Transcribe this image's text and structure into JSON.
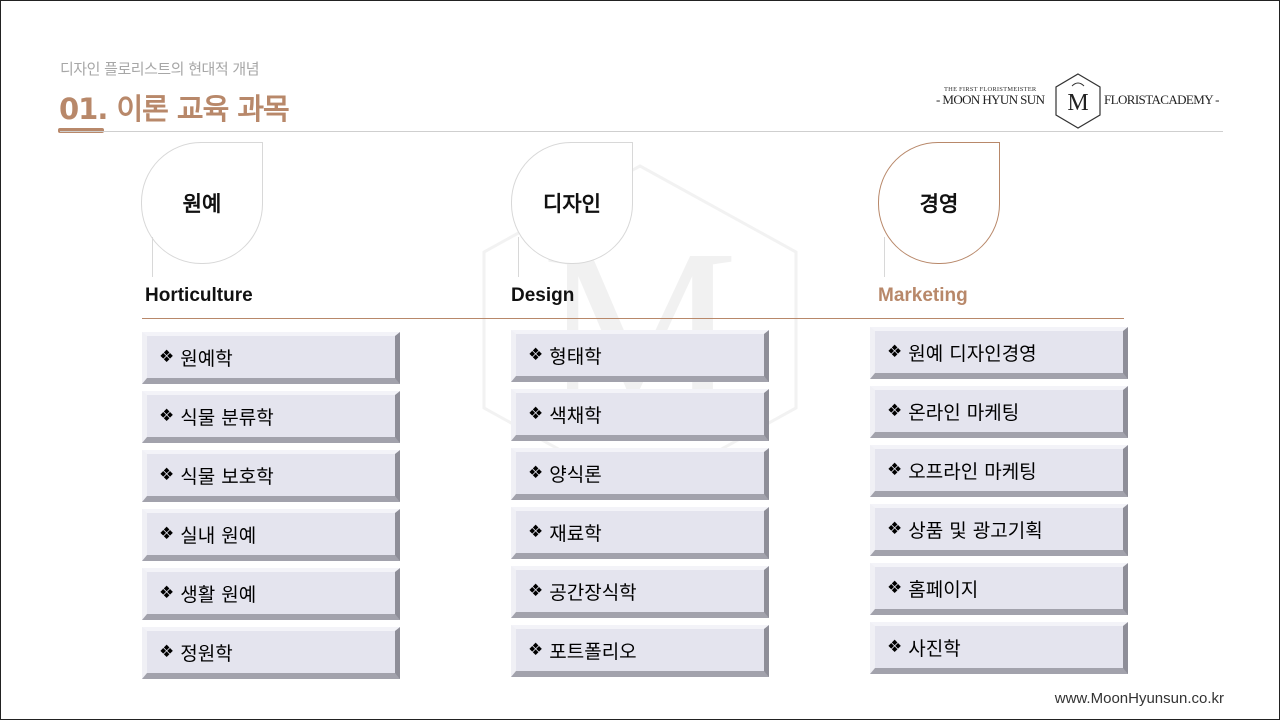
{
  "header": {
    "subtitle": "디자인 플로리스트의 현대적 개념",
    "title": "01. 이론 교육 과목"
  },
  "logo": {
    "tagline": "THE FIRST FLORISTMEISTER",
    "left_text": "- MOON HYUN SUN",
    "right_text": "FLORISTACADEMY -"
  },
  "columns": [
    {
      "title_ko": "원예",
      "title_en": "Horticulture",
      "items": [
        "원예학",
        "식물 분류학",
        "식물 보호학",
        "실내 원예",
        "생활 원예",
        "정원학"
      ]
    },
    {
      "title_ko": "디자인",
      "title_en": "Design",
      "items": [
        "형태학",
        "색채학",
        "양식론",
        "재료학",
        "공간장식학",
        "포트폴리오"
      ]
    },
    {
      "title_ko": "경영",
      "title_en": "Marketing",
      "items": [
        "원예 디자인경영",
        "온라인 마케팅",
        "오프라인 마케팅",
        "상품 및 광고기획",
        "홈페이지",
        "사진학"
      ]
    }
  ],
  "bullet": "❖",
  "footer": {
    "url": "www.MoonHyunsun.co.kr"
  },
  "colors": {
    "accent": "#b8886a",
    "item_bg": "#e4e4ee"
  }
}
